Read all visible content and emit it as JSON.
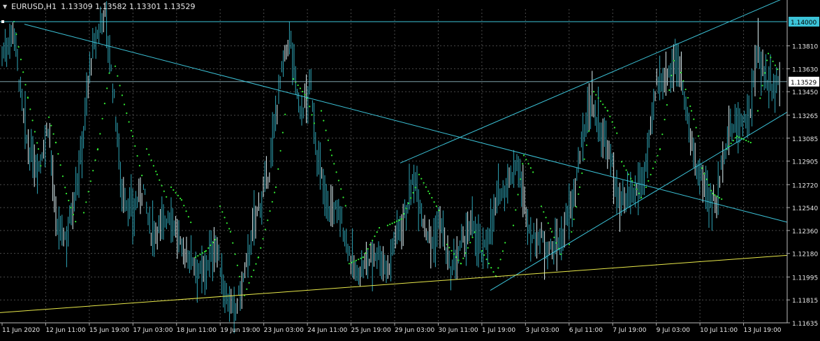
{
  "header": {
    "symbol": "EURUSD,H1",
    "ohlc": "1.13309 1.13582 1.13301 1.13529"
  },
  "colors": {
    "background": "#000000",
    "bars": "#2fa6b8",
    "bar_highlight": "#e0f4f8",
    "sar": "#33ee33",
    "trendline": "#3cc3d8",
    "support": "#e8e84a",
    "grid": "#4a4a4a",
    "axis_text": "#e6e6e6",
    "hline_label_bg": "#3cc3d8"
  },
  "chart_data": {
    "type": "bar",
    "title": "",
    "series": [
      {
        "values_ref": "price_path"
      }
    ],
    "ylim": [
      1.11635,
      1.14
    ],
    "y_ticks": [
      "1.13810",
      "1.13630",
      "1.13450",
      "1.13265",
      "1.13085",
      "1.12905",
      "1.12720",
      "1.12540",
      "1.12360",
      "1.12180",
      "1.11995",
      "1.11815",
      "1.11635"
    ],
    "x_ticks": [
      "11 Jun 2020",
      "12 Jun 11:00",
      "15 Jun 19:00",
      "17 Jun 03:00",
      "18 Jun 11:00",
      "19 Jun 19:00",
      "23 Jun 03:00",
      "24 Jun 11:00",
      "25 Jun 19:00",
      "29 Jun 03:00",
      "30 Jun 11:00",
      "1 Jul 19:00",
      "3 Jul 03:00",
      "6 Jul 11:00",
      "7 Jul 19:00",
      "9 Jul 03:00",
      "10 Jul 11:00",
      "13 Jul 19:00"
    ],
    "price_labels": [
      {
        "price": 1.14,
        "text": "1.14000",
        "style": "hline"
      },
      {
        "price": 1.13529,
        "text": "1.13529",
        "style": "current"
      }
    ],
    "price_path": [
      [
        0,
        1.137
      ],
      [
        20,
        1.1395
      ],
      [
        30,
        1.134
      ],
      [
        40,
        1.13
      ],
      [
        55,
        1.1285
      ],
      [
        70,
        1.132
      ],
      [
        80,
        1.124
      ],
      [
        95,
        1.123
      ],
      [
        115,
        1.129
      ],
      [
        130,
        1.137
      ],
      [
        150,
        1.141
      ],
      [
        165,
        1.133
      ],
      [
        175,
        1.1265
      ],
      [
        190,
        1.125
      ],
      [
        205,
        1.127
      ],
      [
        215,
        1.1235
      ],
      [
        230,
        1.124
      ],
      [
        245,
        1.125
      ],
      [
        260,
        1.122
      ],
      [
        275,
        1.1215
      ],
      [
        290,
        1.12
      ],
      [
        300,
        1.1215
      ],
      [
        310,
        1.1225
      ],
      [
        320,
        1.119
      ],
      [
        335,
        1.117
      ],
      [
        350,
        1.12
      ],
      [
        365,
        1.1245
      ],
      [
        385,
        1.128
      ],
      [
        400,
        1.135
      ],
      [
        415,
        1.139
      ],
      [
        430,
        1.1325
      ],
      [
        445,
        1.135
      ],
      [
        455,
        1.129
      ],
      [
        470,
        1.1255
      ],
      [
        485,
        1.125
      ],
      [
        500,
        1.122
      ],
      [
        510,
        1.12
      ],
      [
        525,
        1.121
      ],
      [
        540,
        1.122
      ],
      [
        555,
        1.1205
      ],
      [
        565,
        1.123
      ],
      [
        580,
        1.125
      ],
      [
        595,
        1.128
      ],
      [
        605,
        1.1245
      ],
      [
        620,
        1.1225
      ],
      [
        630,
        1.1245
      ],
      [
        645,
        1.12
      ],
      [
        655,
        1.1215
      ],
      [
        665,
        1.123
      ],
      [
        680,
        1.124
      ],
      [
        690,
        1.1215
      ],
      [
        700,
        1.1235
      ],
      [
        715,
        1.1265
      ],
      [
        730,
        1.1275
      ],
      [
        740,
        1.129
      ],
      [
        750,
        1.126
      ],
      [
        760,
        1.123
      ],
      [
        775,
        1.123
      ],
      [
        790,
        1.122
      ],
      [
        805,
        1.123
      ],
      [
        820,
        1.126
      ],
      [
        835,
        1.131
      ],
      [
        845,
        1.134
      ],
      [
        860,
        1.1315
      ],
      [
        875,
        1.129
      ],
      [
        885,
        1.126
      ],
      [
        895,
        1.1255
      ],
      [
        910,
        1.1265
      ],
      [
        925,
        1.1285
      ],
      [
        940,
        1.135
      ],
      [
        955,
        1.136
      ],
      [
        970,
        1.137
      ],
      [
        980,
        1.1345
      ],
      [
        990,
        1.13
      ],
      [
        1000,
        1.128
      ],
      [
        1010,
        1.127
      ],
      [
        1025,
        1.1255
      ],
      [
        1035,
        1.1295
      ],
      [
        1045,
        1.1315
      ],
      [
        1060,
        1.132
      ],
      [
        1075,
        1.133
      ],
      [
        1085,
        1.138
      ],
      [
        1095,
        1.1355
      ],
      [
        1105,
        1.135
      ],
      [
        1116,
        1.1353
      ]
    ],
    "sar_segments": [
      [
        [
          20,
          1.14
        ],
        [
          40,
          1.134
        ],
        [
          55,
          1.13
        ],
        [
          60,
          1.128
        ]
      ],
      [
        [
          70,
          1.1325
        ],
        [
          80,
          1.1305
        ],
        [
          95,
          1.1265
        ],
        [
          110,
          1.124
        ]
      ],
      [
        [
          120,
          1.125
        ],
        [
          140,
          1.13
        ],
        [
          158,
          1.1365
        ]
      ],
      [
        [
          165,
          1.1365
        ],
        [
          178,
          1.1335
        ],
        [
          190,
          1.131
        ],
        [
          205,
          1.1275
        ]
      ],
      [
        [
          210,
          1.13
        ],
        [
          225,
          1.128
        ],
        [
          240,
          1.126
        ]
      ],
      [
        [
          245,
          1.127
        ],
        [
          260,
          1.126
        ],
        [
          275,
          1.124
        ]
      ],
      [
        [
          280,
          1.1215
        ],
        [
          295,
          1.122
        ],
        [
          310,
          1.123
        ]
      ],
      [
        [
          315,
          1.1255
        ],
        [
          330,
          1.1235
        ],
        [
          345,
          1.1195
        ]
      ],
      [
        [
          350,
          1.1185
        ],
        [
          370,
          1.1215
        ],
        [
          395,
          1.127
        ],
        [
          410,
          1.1335
        ]
      ],
      [
        [
          420,
          1.1355
        ],
        [
          440,
          1.134
        ],
        [
          450,
          1.132
        ]
      ],
      [
        [
          460,
          1.133
        ],
        [
          475,
          1.1295
        ],
        [
          495,
          1.1255
        ]
      ],
      [
        [
          500,
          1.121
        ],
        [
          520,
          1.1215
        ],
        [
          545,
          1.124
        ]
      ],
      [
        [
          555,
          1.124
        ],
        [
          575,
          1.1245
        ],
        [
          595,
          1.127
        ]
      ],
      [
        [
          600,
          1.128
        ],
        [
          615,
          1.1265
        ],
        [
          630,
          1.125
        ]
      ],
      [
        [
          640,
          1.1225
        ],
        [
          660,
          1.121
        ],
        [
          680,
          1.1235
        ]
      ],
      [
        [
          690,
          1.122
        ],
        [
          710,
          1.12
        ],
        [
          725,
          1.123
        ]
      ],
      [
        [
          735,
          1.124
        ],
        [
          750,
          1.1295
        ],
        [
          765,
          1.128
        ]
      ],
      [
        [
          775,
          1.1255
        ],
        [
          790,
          1.1235
        ],
        [
          805,
          1.1215
        ]
      ],
      [
        [
          815,
          1.1225
        ],
        [
          830,
          1.127
        ],
        [
          845,
          1.132
        ]
      ],
      [
        [
          850,
          1.1345
        ],
        [
          870,
          1.133
        ],
        [
          885,
          1.131
        ]
      ],
      [
        [
          890,
          1.129
        ],
        [
          905,
          1.1275
        ],
        [
          920,
          1.126
        ]
      ],
      [
        [
          925,
          1.127
        ],
        [
          945,
          1.13
        ],
        [
          965,
          1.137
        ]
      ],
      [
        [
          975,
          1.136
        ],
        [
          990,
          1.133
        ],
        [
          1000,
          1.131
        ]
      ],
      [
        [
          1005,
          1.1285
        ],
        [
          1020,
          1.1265
        ],
        [
          1035,
          1.126
        ]
      ],
      [
        [
          1040,
          1.13
        ],
        [
          1055,
          1.131
        ],
        [
          1075,
          1.1305
        ]
      ],
      [
        [
          1085,
          1.133
        ],
        [
          1100,
          1.1375
        ],
        [
          1116,
          1.136
        ]
      ]
    ]
  }
}
